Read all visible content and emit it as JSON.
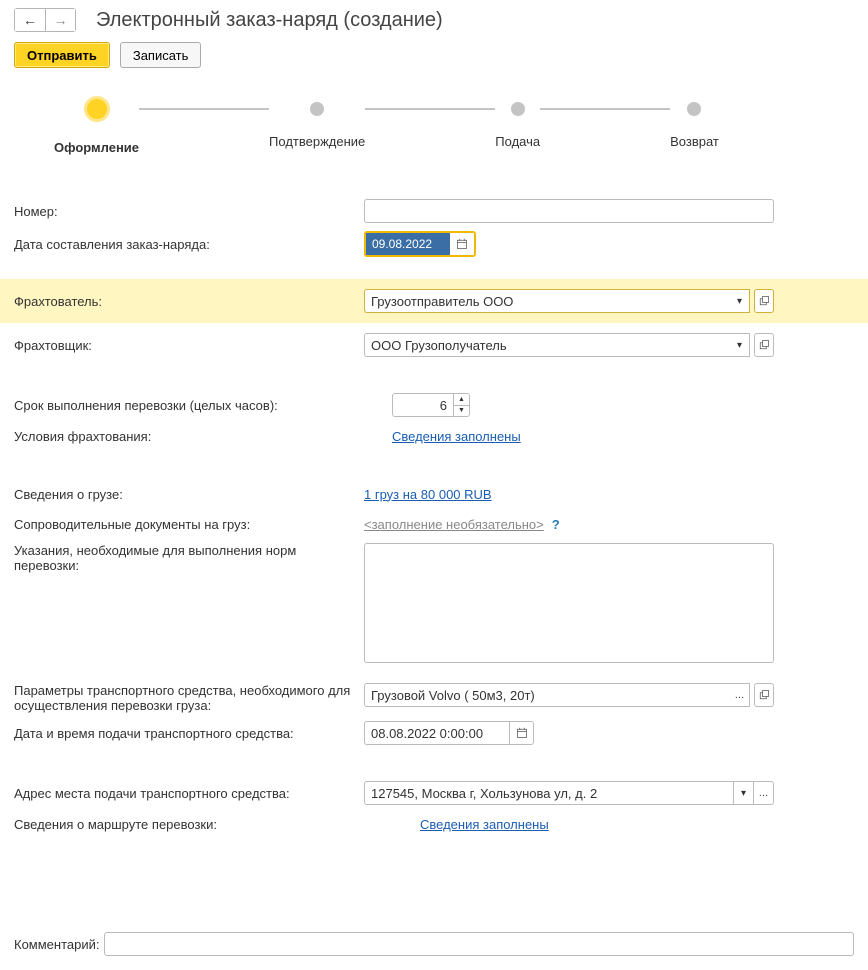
{
  "header": {
    "title": "Электронный заказ-наряд (создание)"
  },
  "actions": {
    "send": "Отправить",
    "save": "Записать"
  },
  "steps": [
    {
      "label": "Оформление",
      "active": true
    },
    {
      "label": "Подтверждение",
      "active": false
    },
    {
      "label": "Подача",
      "active": false
    },
    {
      "label": "Возврат",
      "active": false
    }
  ],
  "form": {
    "number_label": "Номер:",
    "number_value": "",
    "date_label": "Дата составления заказ-наряда:",
    "date_value": "09.08.2022",
    "charterer_label": "Фрахтователь:",
    "charterer_value": "Грузоотправитель ООО",
    "carrier_label": "Фрахтовщик:",
    "carrier_value": "ООО Грузополучатель",
    "duration_label": "Срок выполнения перевозки (целых часов):",
    "duration_value": "6",
    "conditions_label": "Условия фрахтования:",
    "conditions_link": "Сведения заполнены",
    "cargo_label": "Сведения о грузе:",
    "cargo_link": "1 груз на 80 000 RUB",
    "docs_label": "Сопроводительные документы на груз:",
    "docs_placeholder": "<заполнение необязательно>",
    "instructions_label": "Указания, необходимые для выполнения норм перевозки:",
    "instructions_value": "",
    "vehicle_label": "Параметры транспортного средства, необходимого для осуществления перевозки груза:",
    "vehicle_value": "Грузовой Volvo ( 50м3, 20т)",
    "supply_dt_label": "Дата и время подачи транспортного средства:",
    "supply_dt_value": "08.08.2022  0:00:00",
    "address_label": "Адрес места подачи транспортного средства:",
    "address_value": "127545, Москва г, Хользунова ул, д. 2",
    "route_label": "Сведения о маршруте перевозки:",
    "route_link": "Сведения заполнены",
    "comment_label": "Комментарий:",
    "comment_value": ""
  },
  "icons": {
    "dropdown": "▾",
    "open": "⧉",
    "dots": "…",
    "up": "▲",
    "down": "▼"
  }
}
